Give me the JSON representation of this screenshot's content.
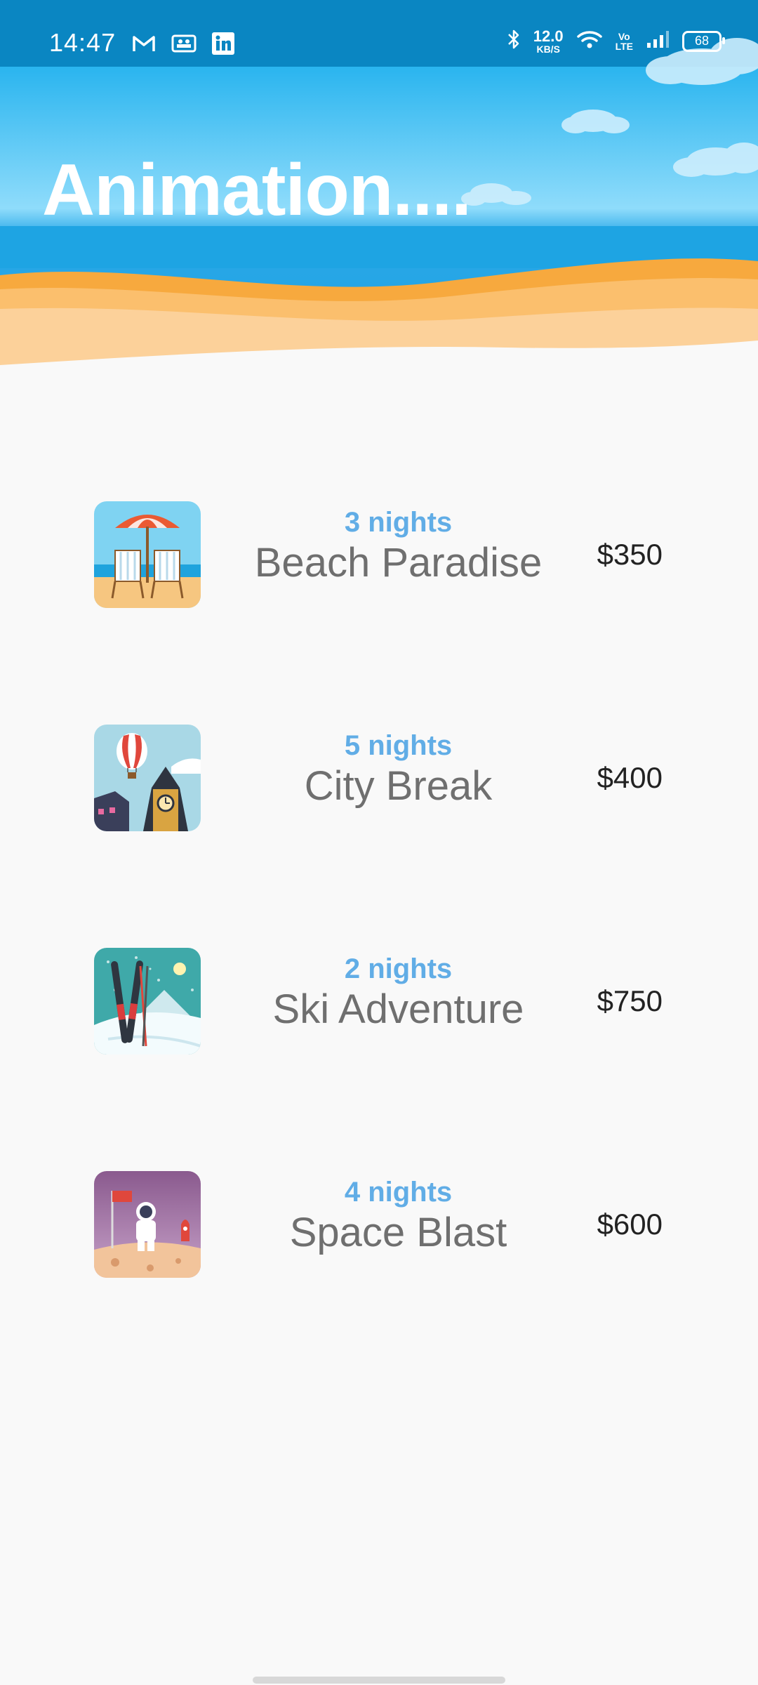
{
  "status_bar": {
    "time": "14:47",
    "left_icons": [
      "gmail-icon",
      "teams-icon",
      "linkedin-icon"
    ],
    "network_speed_value": "12.0",
    "network_speed_unit": "KB/S",
    "volte_label_top": "Vo",
    "volte_label_bottom": "LTE",
    "battery_level": "68"
  },
  "header": {
    "title": "Animation....",
    "sky_color": "#4bc3f3",
    "sand_color": "#fbc477"
  },
  "trips": [
    {
      "nights": "3 nights",
      "name": "Beach Paradise",
      "price": "$350",
      "icon": "beach-chairs-icon"
    },
    {
      "nights": "5 nights",
      "name": "City Break",
      "price": "$400",
      "icon": "city-balloon-icon"
    },
    {
      "nights": "2 nights",
      "name": "Ski Adventure",
      "price": "$750",
      "icon": "skis-icon"
    },
    {
      "nights": "4 nights",
      "name": "Space Blast",
      "price": "$600",
      "icon": "astronaut-icon"
    }
  ],
  "colors": {
    "nights_accent": "#61ade6",
    "name_text": "#6f6f6f",
    "price_text": "#222222",
    "background": "#f9f9f9"
  }
}
